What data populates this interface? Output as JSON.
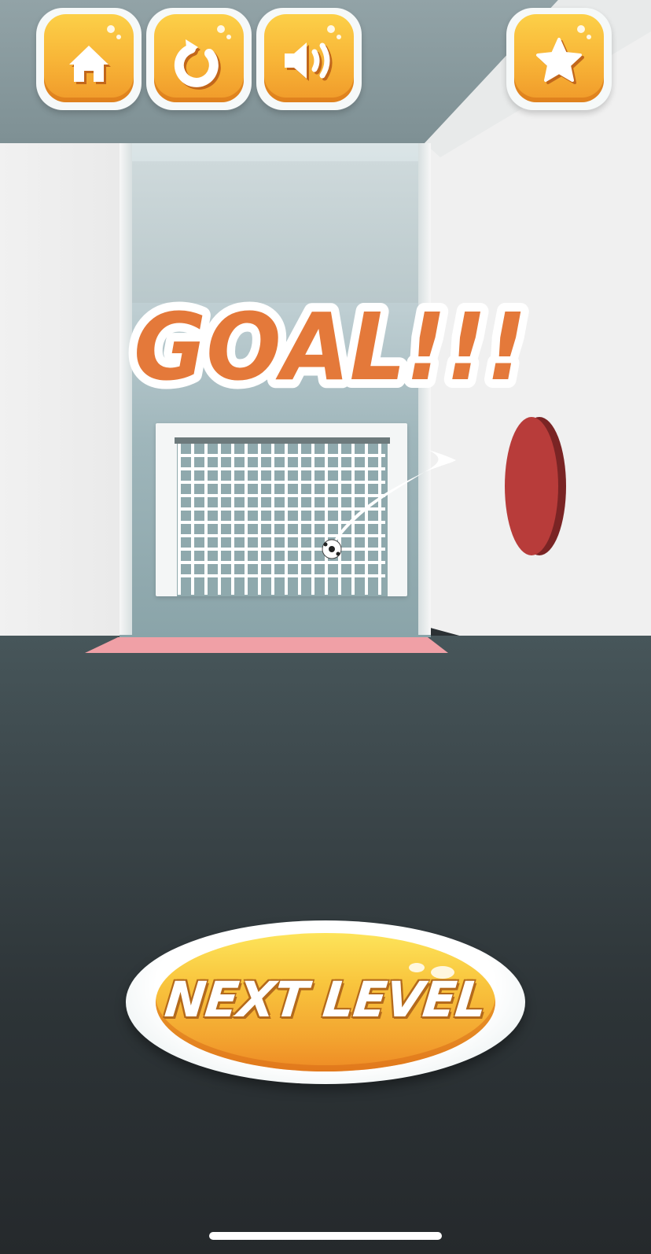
{
  "hud": {
    "buttons": [
      {
        "id": "home",
        "icon": "home-icon"
      },
      {
        "id": "restart",
        "icon": "restart-icon"
      },
      {
        "id": "sound",
        "icon": "speaker-icon"
      },
      {
        "id": "rate",
        "icon": "star-icon"
      }
    ]
  },
  "result": {
    "headline": "GOAL!!!"
  },
  "actions": {
    "next_level_label": "NEXT LEVEL"
  },
  "colors": {
    "accent_orange": "#e4793a",
    "button_yellow": "#f8b638",
    "puck_red": "#b83c3a",
    "mat_pink": "#f0a0a6"
  }
}
